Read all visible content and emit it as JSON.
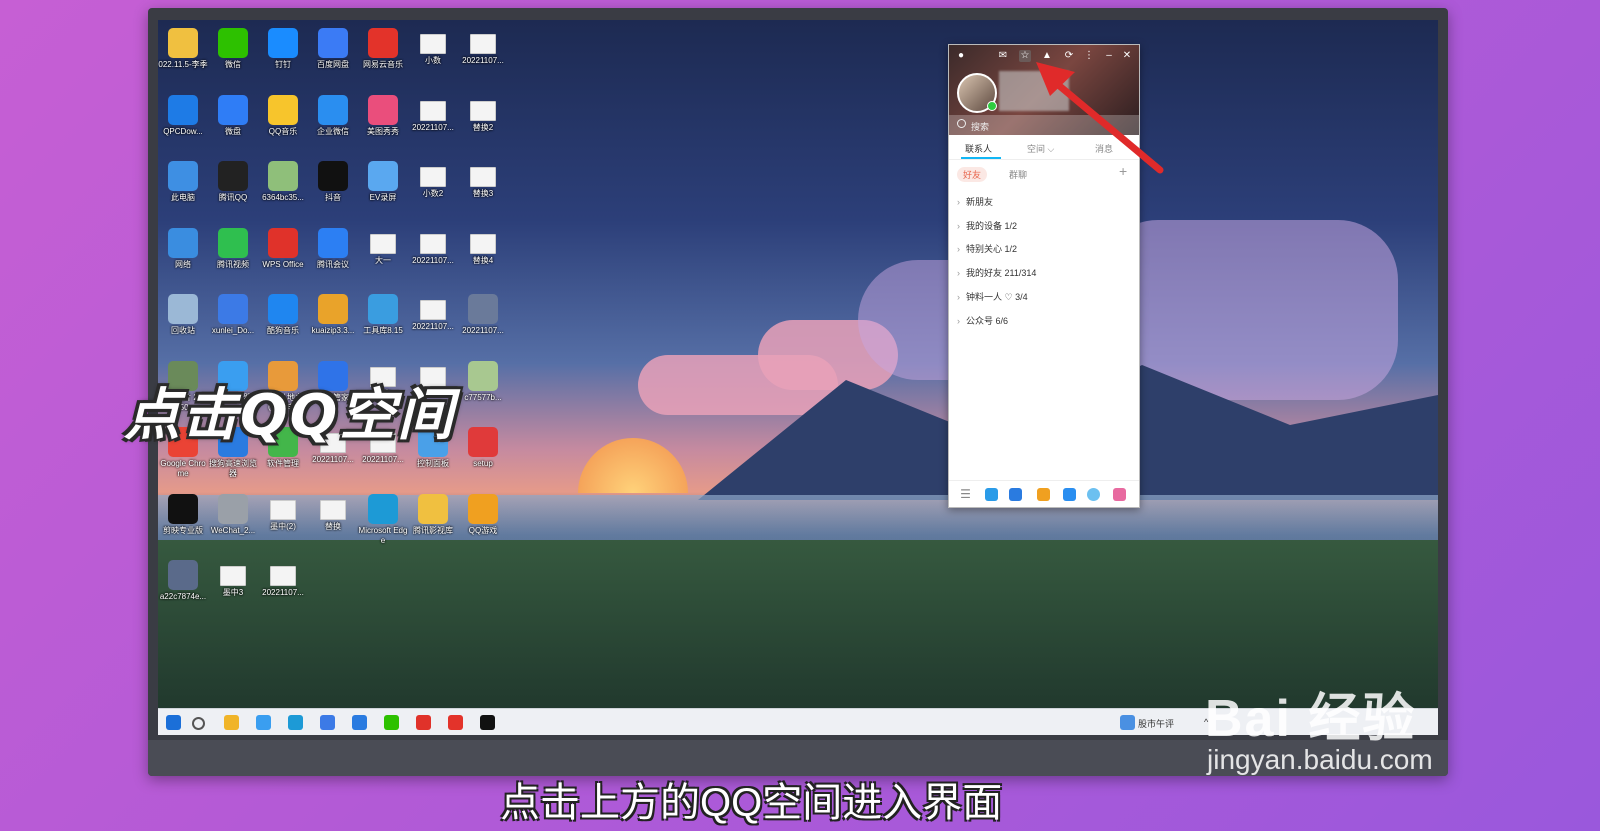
{
  "overlay": {
    "callout": "点击QQ空间",
    "subtitle": "点击上方的QQ空间进入界面"
  },
  "watermark": {
    "brand": "Bai 经验",
    "url": "jingyan.baidu.com"
  },
  "desktop": {
    "icons": [
      {
        "label": "022.11.5-李季",
        "icon": "folder-icon",
        "color": "#f0c040"
      },
      {
        "label": "微信",
        "icon": "wechat-icon",
        "color": "#2dc100"
      },
      {
        "label": "钉钉",
        "icon": "dingtalk-icon",
        "color": "#1a8cff"
      },
      {
        "label": "百度网盘",
        "icon": "baidu-netdisk-icon",
        "color": "#3b7bf5"
      },
      {
        "label": "网易云音乐",
        "icon": "netease-music-icon",
        "color": "#e3332a"
      },
      {
        "label": "小数",
        "icon": "document-icon",
        "color": "#f4f4f4"
      },
      {
        "label": "20221107...",
        "icon": "image-file-icon",
        "color": "#f4f4f4"
      },
      {
        "label": "QPCDow...",
        "icon": "shield-icon",
        "color": "#1e7be6"
      },
      {
        "label": "微盘",
        "icon": "weipan-icon",
        "color": "#2f7df6"
      },
      {
        "label": "QQ音乐",
        "icon": "qq-music-icon",
        "color": "#f7c52c"
      },
      {
        "label": "企业微信",
        "icon": "wecom-icon",
        "color": "#2a8ef0"
      },
      {
        "label": "美图秀秀",
        "icon": "meitu-icon",
        "color": "#ea4e7c"
      },
      {
        "label": "20221107...",
        "icon": "document-icon",
        "color": "#f4f4f4"
      },
      {
        "label": "替换2",
        "icon": "image-file-icon",
        "color": "#f4f4f4"
      },
      {
        "label": "此电脑",
        "icon": "computer-icon",
        "color": "#3e8fe3"
      },
      {
        "label": "腾讯QQ",
        "icon": "qq-penguin-icon",
        "color": "#222222"
      },
      {
        "label": "6364bc35...",
        "icon": "image-file-icon",
        "color": "#8fbf7a"
      },
      {
        "label": "抖音",
        "icon": "douyin-icon",
        "color": "#111111"
      },
      {
        "label": "EV录屏",
        "icon": "ev-recorder-icon",
        "color": "#5aa8f0"
      },
      {
        "label": "小数2",
        "icon": "document-icon",
        "color": "#f4f4f4"
      },
      {
        "label": "替换3",
        "icon": "image-file-icon",
        "color": "#f4f4f4"
      },
      {
        "label": "网络",
        "icon": "network-icon",
        "color": "#3a8de0"
      },
      {
        "label": "腾讯视频",
        "icon": "tencent-video-icon",
        "color": "#2fbf4f"
      },
      {
        "label": "WPS Office",
        "icon": "wps-icon",
        "color": "#e0322a"
      },
      {
        "label": "腾讯会议",
        "icon": "tencent-meeting-icon",
        "color": "#2c7ff3"
      },
      {
        "label": "大一",
        "icon": "document-icon",
        "color": "#f4f4f4"
      },
      {
        "label": "20221107...",
        "icon": "document-icon",
        "color": "#f4f4f4"
      },
      {
        "label": "替换4",
        "icon": "image-file-icon",
        "color": "#f4f4f4"
      },
      {
        "label": "回收站",
        "icon": "recycle-bin-icon",
        "color": "#9bb8d6"
      },
      {
        "label": "xunlei_Do...",
        "icon": "xunlei-icon",
        "color": "#3c7ae6"
      },
      {
        "label": "酷狗音乐",
        "icon": "kugou-icon",
        "color": "#1f86f0"
      },
      {
        "label": "kuaizip3.3...",
        "icon": "kuaizip-icon",
        "color": "#e9a32a"
      },
      {
        "label": "工具库8.15",
        "icon": "toolbox-icon",
        "color": "#3a9de0"
      },
      {
        "label": "20221107...",
        "icon": "document-icon",
        "color": "#f4f4f4"
      },
      {
        "label": "20221107...",
        "icon": "image-file-icon",
        "color": "#6a7a9a"
      },
      {
        "label": "微信图片 2022050...",
        "icon": "image-file-icon",
        "color": "#6a8a5a"
      },
      {
        "label": "QQ浏览器",
        "icon": "qq-browser-icon",
        "color": "#3a9ef0"
      },
      {
        "label": "欢乐斗地主（手游电脑版）",
        "icon": "game-icon",
        "color": "#e89a3a"
      },
      {
        "label": "电脑管家",
        "icon": "pc-manager-icon",
        "color": "#2f73e8"
      },
      {
        "label": "墨中",
        "icon": "document-icon",
        "color": "#f4f4f4"
      },
      {
        "label": "20221107...",
        "icon": "document-icon",
        "color": "#f4f4f4"
      },
      {
        "label": "c77577b...",
        "icon": "image-file-icon",
        "color": "#a8c890"
      },
      {
        "label": "Google Chrome",
        "icon": "chrome-icon",
        "color": "#ea4335"
      },
      {
        "label": "搜狗高速浏览器",
        "icon": "sogou-browser-icon",
        "color": "#2a7be0"
      },
      {
        "label": "软件管理",
        "icon": "software-manager-icon",
        "color": "#43b64a"
      },
      {
        "label": "20221107...",
        "icon": "document-icon",
        "color": "#f4f4f4"
      },
      {
        "label": "20221107...",
        "icon": "image-file-icon",
        "color": "#f4f4f4"
      },
      {
        "label": "控制面板",
        "icon": "control-panel-icon",
        "color": "#4aa0e8"
      },
      {
        "label": "setup",
        "icon": "setup-icon",
        "color": "#e03a3a"
      },
      {
        "label": "剪映专业版",
        "icon": "capcut-icon",
        "color": "#111111"
      },
      {
        "label": "WeChat_2...",
        "icon": "image-file-icon",
        "color": "#9aa0a8"
      },
      {
        "label": "墨中(2)",
        "icon": "document-icon",
        "color": "#f4f4f4"
      },
      {
        "label": "替换",
        "icon": "image-file-icon",
        "color": "#f4f4f4"
      },
      {
        "label": "Microsoft Edge",
        "icon": "edge-icon",
        "color": "#1d9ad6"
      },
      {
        "label": "腾讯影视库",
        "icon": "folder-icon",
        "color": "#f0c040"
      },
      {
        "label": "QQ游戏",
        "icon": "qq-game-icon",
        "color": "#f0a020"
      },
      {
        "label": "a22c7874e...",
        "icon": "image-file-icon",
        "color": "#5a6a8a"
      },
      {
        "label": "墨中3",
        "icon": "document-icon",
        "color": "#f4f4f4"
      },
      {
        "label": "20221107...",
        "icon": "image-file-icon",
        "color": "#f4f4f4"
      }
    ]
  },
  "taskbar": {
    "weather": "股市午评",
    "items": [
      {
        "icon": "windows-start-icon",
        "color": "#1b6fd8"
      },
      {
        "icon": "search-circle-icon",
        "color": "#555555"
      },
      {
        "icon": "file-explorer-icon",
        "color": "#f0b429"
      },
      {
        "icon": "qq-browser-icon",
        "color": "#3a9ef0"
      },
      {
        "icon": "edge-icon",
        "color": "#1d9ad6"
      },
      {
        "icon": "xunlei-icon",
        "color": "#3c7ae6"
      },
      {
        "icon": "sogou-browser-icon",
        "color": "#2a7be0"
      },
      {
        "icon": "wechat-icon",
        "color": "#2dc100"
      },
      {
        "icon": "wps-icon",
        "color": "#e0322a"
      },
      {
        "icon": "netease-music-icon",
        "color": "#e3332a"
      },
      {
        "icon": "douyin-icon",
        "color": "#111111"
      }
    ]
  },
  "qq": {
    "search_placeholder": "搜索",
    "tabs": [
      {
        "label": "联系人"
      },
      {
        "label": "空间 ⌵"
      },
      {
        "label": "消息"
      }
    ],
    "subtabs": [
      {
        "label": "好友"
      },
      {
        "label": "群聊"
      }
    ],
    "add": "+",
    "groups": [
      {
        "label": "新朋友"
      },
      {
        "label": "我的设备 1/2"
      },
      {
        "label": "特别关心 1/2"
      },
      {
        "label": "我的好友 211/314"
      },
      {
        "label": "钟料一人 ♡ 3/4"
      },
      {
        "label": "公众号 6/6"
      }
    ],
    "accent": "#12b7f5"
  }
}
